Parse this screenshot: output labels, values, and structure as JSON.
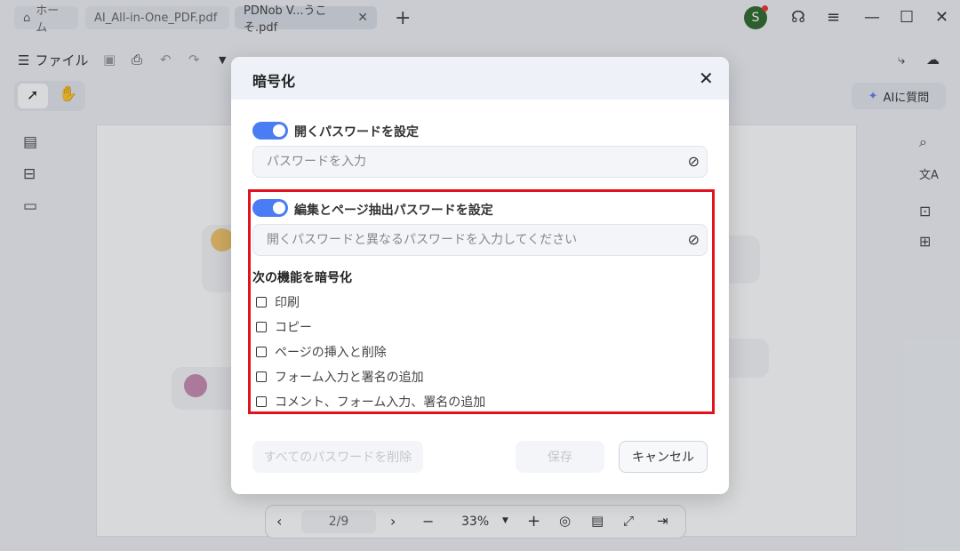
{
  "titlebar": {
    "tabs": [
      {
        "label": "ホーム"
      },
      {
        "label": "AI_All-in-One_PDF.pdf"
      },
      {
        "label": "PDNob V...うこそ.pdf"
      }
    ],
    "avatar_initial": "S"
  },
  "toolbar": {
    "file_menu": "ファイル",
    "ai_button": "AIに質問"
  },
  "bottombar": {
    "page": "2/9",
    "zoom": "33%"
  },
  "dialog": {
    "title": "暗号化",
    "open_password": {
      "label": "開くパスワードを設定",
      "enabled": true,
      "placeholder": "パスワードを入力"
    },
    "edit_password": {
      "label": "編集とページ抽出パスワードを設定",
      "enabled": true,
      "placeholder": "開くパスワードと異なるパスワードを入力してください"
    },
    "encrypt_section_title": "次の機能を暗号化",
    "permissions": [
      {
        "label": "印刷",
        "checked": false
      },
      {
        "label": "コピー",
        "checked": false
      },
      {
        "label": "ページの挿入と削除",
        "checked": false
      },
      {
        "label": "フォーム入力と署名の追加",
        "checked": false
      },
      {
        "label": "コメント、フォーム入力、署名の追加",
        "checked": false
      }
    ],
    "buttons": {
      "delete_all": "すべてのパスワードを削除",
      "save": "保存",
      "cancel": "キャンセル"
    }
  },
  "colors": {
    "accent": "#4a7cf3",
    "highlight_border": "#e0141e"
  }
}
